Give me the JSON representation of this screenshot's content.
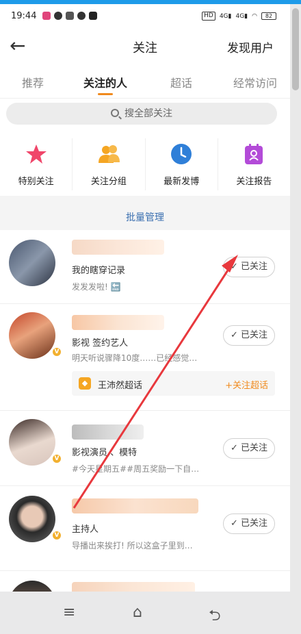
{
  "status": {
    "time": "19:44",
    "battery": "82"
  },
  "nav": {
    "title": "关注",
    "discover": "发现用户",
    "back_icon": "back-arrow-icon"
  },
  "tabs": [
    "推荐",
    "关注的人",
    "超话",
    "经常访问"
  ],
  "search": {
    "placeholder": "搜全部关注"
  },
  "quick": [
    {
      "label": "特别关注",
      "icon": "star-icon"
    },
    {
      "label": "关注分组",
      "icon": "group-icon"
    },
    {
      "label": "最新发博",
      "icon": "clock-icon"
    },
    {
      "label": "关注报告",
      "icon": "report-icon"
    }
  ],
  "batch": "批量管理",
  "follow_label": "已关注",
  "users": [
    {
      "desc": "我的瞎穿记录",
      "sub": "发发发啦! 🔚"
    },
    {
      "desc": "影视 签约艺人",
      "sub": "明天听说骤降10度……已经感觉…",
      "super_name": "王沛然超话",
      "super_follow": "+关注超话"
    },
    {
      "desc": "影视演员 、模特",
      "sub": "#今天星期五##周五奖励一下自…"
    },
    {
      "desc": "主持人",
      "sub": "导播出来挨打! 所以这盒子里到…"
    },
    {
      "desc": "",
      "sub": ""
    }
  ],
  "colors": {
    "accent": "#f08a1d",
    "link": "#3a6fb0",
    "arrow": "#e8383d"
  }
}
